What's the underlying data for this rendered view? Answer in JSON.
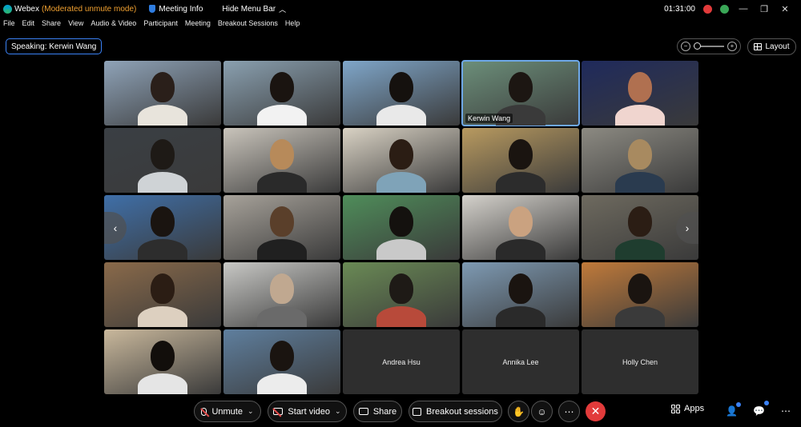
{
  "titlebar": {
    "app_name": "Webex",
    "mode": "(Moderated unmute mode)",
    "meeting_info": "Meeting Info",
    "hide_menu": "Hide Menu Bar",
    "timer": "01:31:00"
  },
  "menu": [
    "File",
    "Edit",
    "Share",
    "View",
    "Audio & Video",
    "Participant",
    "Meeting",
    "Breakout Sessions",
    "Help"
  ],
  "speaking": {
    "label": "Speaking: Kerwin Wang"
  },
  "layout_button": "Layout",
  "tiles": [
    {
      "label": "",
      "bg": "#8fa3b8",
      "head": "#2a1f1a",
      "body": "#e8e4dc"
    },
    {
      "label": "",
      "bg": "#8aa0b0",
      "head": "#1a1410",
      "body": "#f2f2f2"
    },
    {
      "label": "",
      "bg": "#7fa6c9",
      "head": "#15110e",
      "body": "#e9e9e9"
    },
    {
      "label": "Kerwin Wang",
      "bg": "#6c8f7a",
      "head": "#1c1612",
      "body": "#3a3a3a"
    },
    {
      "label": "",
      "bg": "#1f2a5c",
      "head": "#b07050",
      "body": "#f0d5cf"
    },
    {
      "label": "",
      "bg": "#3a3f44",
      "head": "#1e1a16",
      "body": "#cfd3d6"
    },
    {
      "label": "",
      "bg": "#c9c4bb",
      "head": "#b78a5a",
      "body": "#2a2a2a"
    },
    {
      "label": "",
      "bg": "#d9d2c4",
      "head": "#2b1d14",
      "body": "#7fa3b8"
    },
    {
      "label": "",
      "bg": "#b89a60",
      "head": "#1a1410",
      "body": "#2c2c2c"
    },
    {
      "label": "",
      "bg": "#8c8a82",
      "head": "#a88a60",
      "body": "#2a3b4f"
    },
    {
      "label": "",
      "bg": "#3f6fa8",
      "head": "#1a1410",
      "body": "#2d2d2d"
    },
    {
      "label": "",
      "bg": "#a7a29a",
      "head": "#5a3f2a",
      "body": "#202020"
    },
    {
      "label": "",
      "bg": "#4f8d5a",
      "head": "#14110e",
      "body": "#c9c9c9"
    },
    {
      "label": "",
      "bg": "#d4d1cb",
      "head": "#caa280",
      "body": "#2a2a2a"
    },
    {
      "label": "",
      "bg": "#6e6a5f",
      "head": "#2b1d14",
      "body": "#1f3d2f"
    },
    {
      "label": "",
      "bg": "#8a6a4a",
      "head": "#2b1d14",
      "body": "#ddd0c0"
    },
    {
      "label": "",
      "bg": "#c8c8c5",
      "head": "#c0a890",
      "body": "#6a6a6a"
    },
    {
      "label": "",
      "bg": "#6a8a55",
      "head": "#1e1a16",
      "body": "#b84a3a"
    },
    {
      "label": "",
      "bg": "#7e9ab3",
      "head": "#1a1410",
      "body": "#2a2a2a"
    },
    {
      "label": "",
      "bg": "#c07a3a",
      "head": "#1a1410",
      "body": "#3a3a3a"
    },
    {
      "label": "",
      "bg": "#c9b89c",
      "head": "#120e0b",
      "body": "#e5e5e5"
    },
    {
      "label": "",
      "bg": "#5f7f9e",
      "head": "#1a1410",
      "body": "#ececec"
    },
    {
      "label": "Andrea Hsu",
      "name_only": true
    },
    {
      "label": "Annika Lee",
      "name_only": true
    },
    {
      "label": "Holly Chen",
      "name_only": true
    }
  ],
  "controls": {
    "unmute": "Unmute",
    "start_video": "Start video",
    "share": "Share",
    "breakout": "Breakout sessions",
    "apps": "Apps",
    "end_icon": "close-icon"
  },
  "colors": {
    "mode": "#f0a030",
    "active_border": "#6ea8e8",
    "end_call": "#e23b3b",
    "speaking_border": "#3b82f6"
  }
}
